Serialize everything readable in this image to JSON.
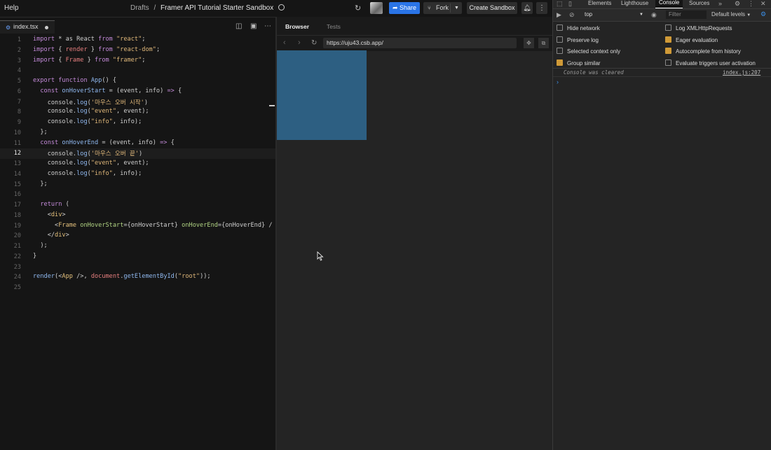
{
  "topbar": {
    "help": "Help",
    "breadcrumb_parent": "Drafts",
    "breadcrumb_sep": "/",
    "sandbox_title": "Framer API Tutorial Starter Sandbox",
    "share": "Share",
    "fork": "Fork",
    "create_sandbox": "Create Sandbox"
  },
  "editor": {
    "file_tab": "index.tsx",
    "lines": [
      {
        "n": "1"
      },
      {
        "n": "2"
      },
      {
        "n": "3"
      },
      {
        "n": "4"
      },
      {
        "n": "5"
      },
      {
        "n": "6"
      },
      {
        "n": "7"
      },
      {
        "n": "8"
      },
      {
        "n": "9"
      },
      {
        "n": "10"
      },
      {
        "n": "11"
      },
      {
        "n": "12"
      },
      {
        "n": "13"
      },
      {
        "n": "14"
      },
      {
        "n": "15"
      },
      {
        "n": "16"
      },
      {
        "n": "17"
      },
      {
        "n": "18"
      },
      {
        "n": "19"
      },
      {
        "n": "20"
      },
      {
        "n": "21"
      },
      {
        "n": "22"
      },
      {
        "n": "23"
      },
      {
        "n": "24"
      },
      {
        "n": "25"
      }
    ],
    "active_line": "12",
    "code": {
      "l1": [
        "import",
        " * as React ",
        "from",
        " ",
        "\"react\"",
        ";"
      ],
      "l2": [
        "import",
        " { ",
        "render",
        " } ",
        "from",
        " ",
        "\"react-dom\"",
        ";"
      ],
      "l3": [
        "import",
        " { ",
        "Frame",
        " } ",
        "from",
        " ",
        "\"framer\"",
        ";"
      ],
      "l5": [
        "export",
        " ",
        "function",
        " ",
        "App",
        "() {"
      ],
      "l6": [
        "  const",
        " ",
        "onHoverStart",
        " = (event, info) ",
        "=>",
        " {"
      ],
      "l7": [
        "    console.",
        "log",
        "(",
        "'마우스 오버 시작'",
        ")"
      ],
      "l8": [
        "    console.",
        "log",
        "(",
        "\"event\"",
        ", event);"
      ],
      "l9": [
        "    console.",
        "log",
        "(",
        "\"info\"",
        ", info);"
      ],
      "l10": [
        "  };"
      ],
      "l11": [
        "  const",
        " ",
        "onHoverEnd",
        " = (event, info) ",
        "=>",
        " {"
      ],
      "l12": [
        "    console.",
        "log",
        "(",
        "'마우스 오버 끝'",
        ")"
      ],
      "l13": [
        "    console.",
        "log",
        "(",
        "\"event\"",
        ", event);"
      ],
      "l14": [
        "    console.",
        "log",
        "(",
        "\"info\"",
        ", info);"
      ],
      "l15": [
        "  };"
      ],
      "l17": [
        "  return",
        " ("
      ],
      "l18": [
        "    <",
        "div",
        ">"
      ],
      "l19": [
        "      <",
        "Frame",
        " ",
        "onHoverStart",
        "={onHoverStart} ",
        "onHoverEnd",
        "={onHoverEnd} /"
      ],
      "l20": [
        "    </",
        "div",
        ">"
      ],
      "l21": [
        "  );"
      ],
      "l22": [
        "}"
      ],
      "l24": [
        "render",
        "(<",
        "App",
        " />, ",
        "document",
        ".",
        "getElementById",
        "(",
        "\"root\"",
        "));"
      ]
    }
  },
  "browser": {
    "tab_browser": "Browser",
    "tab_tests": "Tests",
    "url": "https://uju43.csb.app/",
    "frame_color": "#2d5f82"
  },
  "devtools": {
    "tabs": [
      "Elements",
      "Lighthouse",
      "Console",
      "Sources"
    ],
    "active_tab": "Console",
    "context": "top",
    "filter_placeholder": "Filter",
    "levels": "Default levels",
    "options": [
      {
        "label": "Hide network",
        "checked": false
      },
      {
        "label": "Log XMLHttpRequests",
        "checked": false
      },
      {
        "label": "Preserve log",
        "checked": false
      },
      {
        "label": "Eager evaluation",
        "checked": true
      },
      {
        "label": "Selected context only",
        "checked": false
      },
      {
        "label": "Autocomplete from history",
        "checked": true
      },
      {
        "label": "Group similar",
        "checked": true
      },
      {
        "label": "Evaluate triggers user activation",
        "checked": false
      }
    ],
    "console_cleared": "Console was cleared",
    "source_link": "index.js:207",
    "accent_color": "#3a8ee6"
  }
}
